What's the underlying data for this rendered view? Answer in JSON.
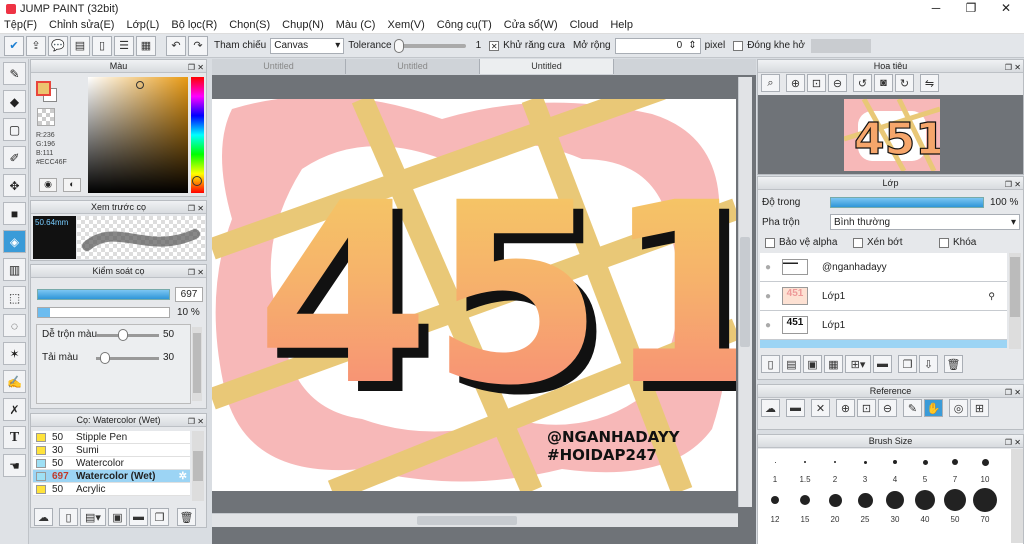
{
  "app": {
    "title": "JUMP PAINT (32bit)"
  },
  "menu": [
    "Tệp(F)",
    "Chỉnh sửa(E)",
    "Lớp(L)",
    "Bộ lọc(R)",
    "Chọn(S)",
    "Chụp(N)",
    "Màu (C)",
    "Xem(V)",
    "Công cụ(T)",
    "Cửa sổ(W)",
    "Cloud",
    "Help"
  ],
  "toolbar": {
    "ref_label": "Tham chiếu",
    "ref_value": "Canvas",
    "tolerance_label": "Tolerance",
    "tolerance_value": "1",
    "antialias_label": "Khử răng cưa",
    "expand_label": "Mở rộng",
    "expand_value": "0",
    "expand_unit": "pixel",
    "close_gap_label": "Đóng khe hở"
  },
  "color_panel": {
    "title": "Màu",
    "r": "R:236",
    "g": "G:196",
    "b": "B:111",
    "hex": "#ECC46F",
    "fg": "#ECC46F",
    "bg": "#ffffff"
  },
  "preview_panel": {
    "title": "Xem trước cọ",
    "size": "50.64mm"
  },
  "control_panel": {
    "title": "Kiểm soát cọ",
    "size_value": "697",
    "opacity_value": "10 %",
    "mix_label": "Dễ trộn màu",
    "mix_value": "50",
    "load_label": "Tải màu",
    "load_value": "30"
  },
  "brush_panel": {
    "title": "Cọ: Watercolor (Wet)",
    "items": [
      {
        "size": "50",
        "name": "Stipple Pen",
        "color": "#ffe33b",
        "selected": false
      },
      {
        "size": "30",
        "name": "Sumi",
        "color": "#ffe33b",
        "selected": false
      },
      {
        "size": "50",
        "name": "Watercolor",
        "color": "#9fe0f5",
        "selected": false
      },
      {
        "size": "697",
        "name": "Watercolor (Wet)",
        "color": "#9fe0f5",
        "selected": true
      },
      {
        "size": "50",
        "name": "Acrylic",
        "color": "#ffe33b",
        "selected": false
      }
    ]
  },
  "tabs": [
    "Untitled",
    "Untitled",
    "Untitled"
  ],
  "artwork": {
    "number": "451",
    "credit1": "@NGANHADAYY",
    "credit2": "#HOIDAP247"
  },
  "navigator": {
    "title": "Hoa tiêu"
  },
  "layers_panel": {
    "title": "Lớp",
    "opacity_label": "Độ trong",
    "opacity_value": "100 %",
    "blend_label": "Pha trộn",
    "blend_value": "Bình thường",
    "protect_alpha": "Bảo vệ alpha",
    "clip": "Xén bớt",
    "lock": "Khóa",
    "layers": [
      "@nganhadayy",
      "Lớp1",
      "Lớp1"
    ]
  },
  "reference_panel": {
    "title": "Reference"
  },
  "brush_size_panel": {
    "title": "Brush Size",
    "row1": [
      "1",
      "1.5",
      "2",
      "3",
      "4",
      "5",
      "7",
      "10"
    ],
    "row2": [
      "12",
      "15",
      "20",
      "25",
      "30",
      "40",
      "50",
      "70"
    ]
  }
}
